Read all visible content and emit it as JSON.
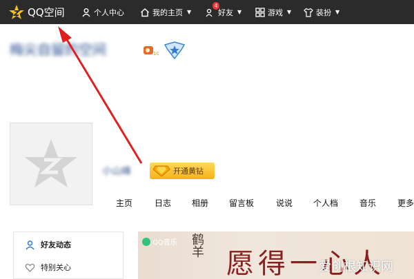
{
  "topnav": {
    "logo_text": "QQ空间",
    "items": [
      {
        "label": "个人中心",
        "icon": "person-icon",
        "has_caret": false
      },
      {
        "label": "我的主页",
        "icon": "home-icon",
        "has_caret": true
      },
      {
        "label": "好友",
        "icon": "friends-icon",
        "has_caret": true,
        "badge": "4"
      },
      {
        "label": "游戏",
        "icon": "grid-icon",
        "has_caret": true
      },
      {
        "label": "装扮",
        "icon": "shirt-icon",
        "has_caret": true
      }
    ]
  },
  "header": {
    "space_title": "梅尖自留的空间",
    "icons": [
      "medal-icon",
      "star-shield-icon"
    ]
  },
  "profile": {
    "username": "小山峰",
    "vip_button": "开通黄钻"
  },
  "tabs": [
    "主页",
    "日志",
    "相册",
    "留言板",
    "说说",
    "个人档",
    "音乐",
    "更多"
  ],
  "sidebar": {
    "items": [
      {
        "label": "好友动态",
        "icon": "person-outline-icon"
      },
      {
        "label": "特别关心",
        "icon": "heart-icon"
      }
    ]
  },
  "banner": {
    "brand": "QQ音乐",
    "small_text": "鹤\n羊",
    "big_text": "愿得一心人"
  },
  "watermark": "爱创根知识网",
  "colors": {
    "topbar_bg": "#2b2b2b",
    "arrow": "#e02020",
    "vip_gold": "#f6b21b"
  }
}
